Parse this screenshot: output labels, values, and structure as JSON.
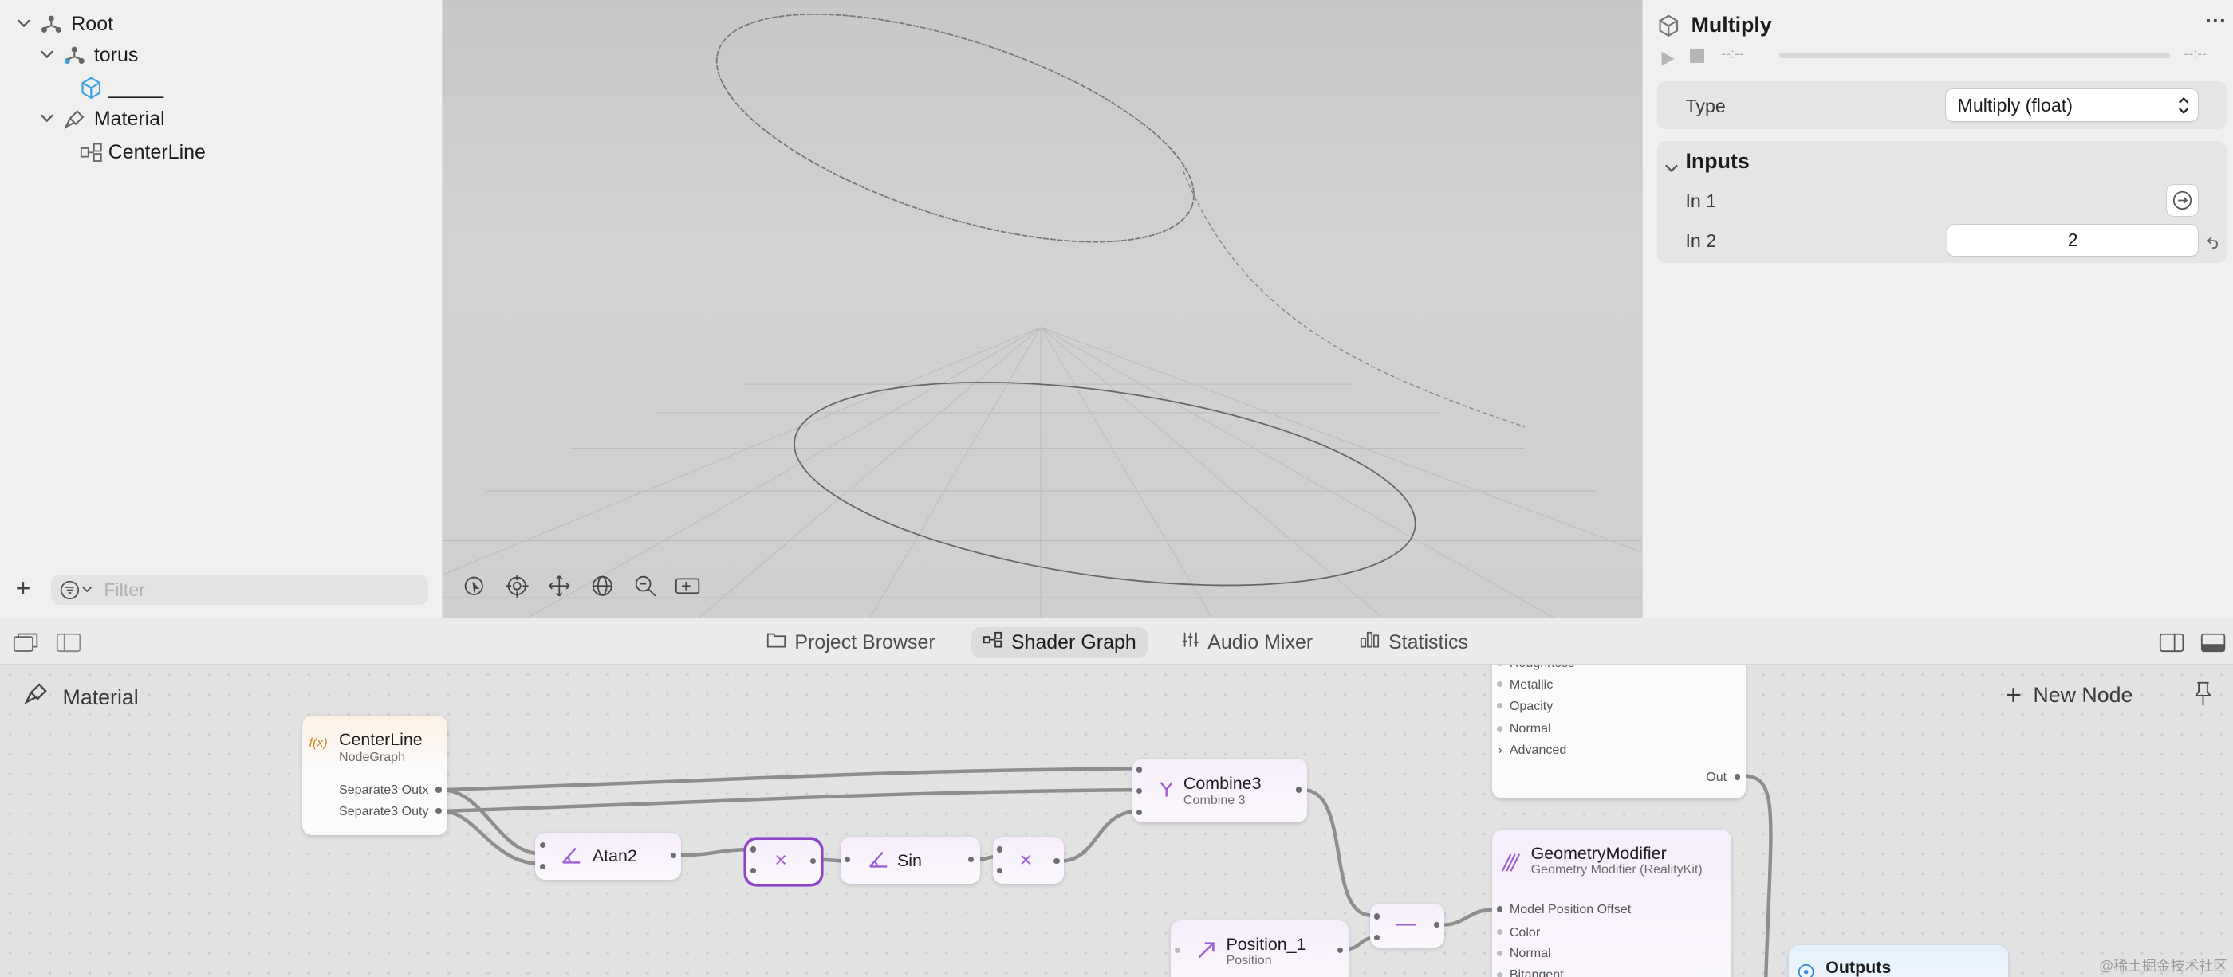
{
  "scene_tree": {
    "items": [
      {
        "label": "Root"
      },
      {
        "label": "torus"
      },
      {
        "label": "_____"
      },
      {
        "label": "Material"
      },
      {
        "label": "CenterLine"
      }
    ],
    "filter_placeholder": "Filter"
  },
  "inspector": {
    "title": "Multiply",
    "time_left": "--:--",
    "time_right": "--:--",
    "type_label": "Type",
    "type_value": "Multiply (float)",
    "inputs_header": "Inputs",
    "in1_label": "In 1",
    "in2_label": "In 2",
    "in2_value": "2"
  },
  "tabs": [
    {
      "label": "Project Browser",
      "icon": "folder-icon",
      "selected": false
    },
    {
      "label": "Shader Graph",
      "icon": "graph-icon",
      "selected": true
    },
    {
      "label": "Audio Mixer",
      "icon": "sliders-icon",
      "selected": false
    },
    {
      "label": "Statistics",
      "icon": "bar-chart-icon",
      "selected": false
    }
  ],
  "graph": {
    "breadcrumb": "Material",
    "new_node": "New Node",
    "nodes": {
      "centerline": {
        "title": "CenterLine",
        "sub": "NodeGraph",
        "out1": "Separate3 Outx",
        "out2": "Separate3 Outy"
      },
      "atan2": {
        "title": "Atan2"
      },
      "multiply1": {
        "symbol": "×"
      },
      "sin": {
        "title": "Sin"
      },
      "multiply2": {
        "symbol": "×"
      },
      "combine3": {
        "title": "Combine3",
        "sub": "Combine 3"
      },
      "subtract": {
        "symbol": "—"
      },
      "position": {
        "title": "Position_1",
        "sub": "Position"
      },
      "surface": {
        "inputs": [
          "Roughness",
          "Metallic",
          "Opacity",
          "Normal",
          "Advanced"
        ],
        "out": "Out"
      },
      "geometry": {
        "title": "GeometryModifier",
        "sub": "Geometry Modifier (RealityKit)",
        "inputs": [
          "Model Position Offset",
          "Color",
          "Normal",
          "Bitangent"
        ]
      },
      "outputs": {
        "title": "Outputs"
      }
    }
  },
  "watermark": "@稀土掘金技术社区",
  "colors": {
    "accent": "#9b5fd0",
    "selection": "#8e44c9",
    "folder_blue": "#3fa0e0"
  }
}
